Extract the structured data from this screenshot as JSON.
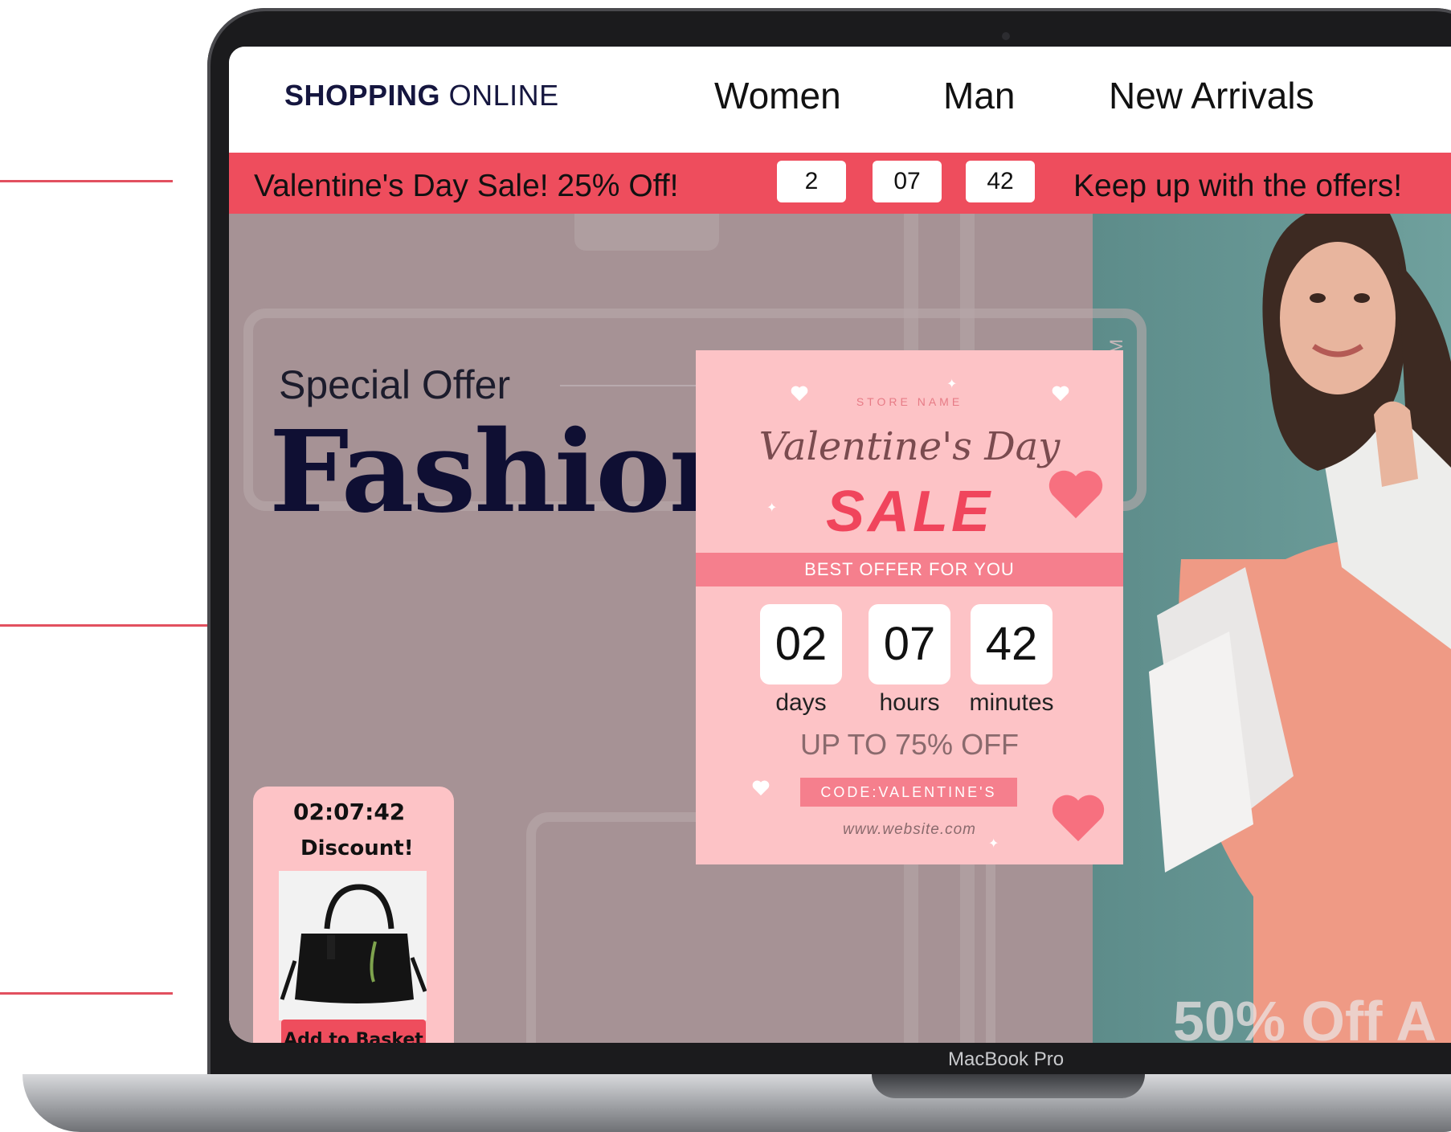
{
  "nav": {
    "logo_bold": "SHOPPING",
    "logo_rest": "ONLINE",
    "links": [
      "Women",
      "Man",
      "New Arrivals"
    ]
  },
  "promo_bar": {
    "left_text": "Valentine's Day Sale! 25% Off!",
    "countdown": [
      "2",
      "07",
      "42"
    ],
    "right_text": "Keep up with the offers!"
  },
  "hero": {
    "special_offer": "Special Offer",
    "title": "Fashion",
    "vertical_text": "LOREM IPSUM",
    "offer_text": "50% Off A"
  },
  "valentine_card": {
    "store_name": "STORE NAME",
    "title": "Valentine's Day",
    "sale": "SALE",
    "best_offer": "BEST OFFER FOR YOU",
    "timer": [
      {
        "value": "02",
        "label": "days"
      },
      {
        "value": "07",
        "label": "hours"
      },
      {
        "value": "42",
        "label": "minutes"
      }
    ],
    "discount": "UP TO 75% OFF",
    "code": "CODE:VALENTINE'S",
    "website": "www.website.com"
  },
  "discount_widget": {
    "timer": "02:07:42",
    "label": "Discount!",
    "button": "Add to Basket"
  },
  "device": {
    "label": "MacBook Pro"
  },
  "colors": {
    "accent": "#ee4d5d",
    "card_pink": "#fdc3c6",
    "navy": "#15163f"
  }
}
